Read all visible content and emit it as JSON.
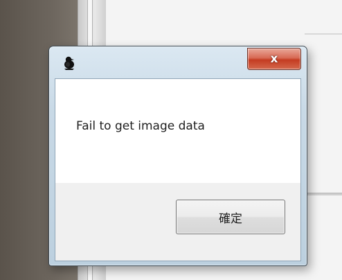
{
  "dialog": {
    "close_glyph": "x",
    "message": "Fail to get image data",
    "ok_label": "確定",
    "app_icon": "penguin-app-icon"
  },
  "colors": {
    "frame": "#c8d9e6",
    "close_button": "#d05038",
    "content_bg": "#ffffff",
    "button_area_bg": "#f0f0f0"
  }
}
